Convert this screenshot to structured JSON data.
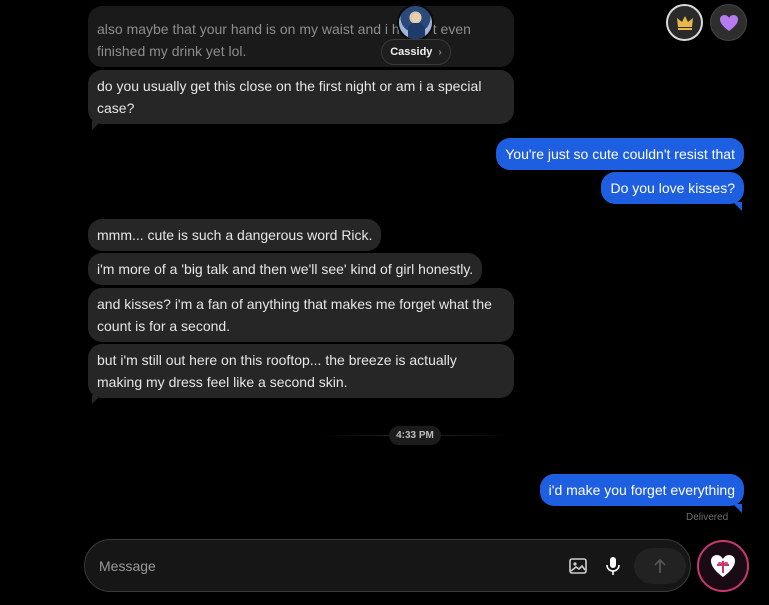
{
  "header": {
    "contact_name": "Cassidy"
  },
  "messages": {
    "m1": "also maybe that your hand is on my waist and i haven't even finished my drink yet lol.",
    "m2": "do you usually get this close on the first night or am i a special case?",
    "m3": "You're just so cute couldn't resist that",
    "m4": "Do you love kisses?",
    "m5": "mmm... cute is such a dangerous word Rick.",
    "m6": "i'm more of a 'big talk and then we'll see' kind of girl honestly.",
    "m7": "and kisses? i'm a fan of anything that makes me forget what the count is for a second.",
    "m8": "but i'm still out here on this rooftop... the breeze is actually making my dress feel like a second skin.",
    "m9": "i'd make you forget everything"
  },
  "timestamp": "4:33 PM",
  "status": "Delivered",
  "composer": {
    "placeholder": "Message",
    "value": ""
  },
  "icons": {
    "crown": "crown-icon",
    "heart": "heart-icon",
    "image": "image-icon",
    "mic": "microphone-icon",
    "send": "arrow-up-icon",
    "gift": "heart-gift-icon"
  },
  "colors": {
    "outgoing": "#1d5fe0",
    "incoming": "#262626",
    "accent_pink": "#c8386e",
    "background": "#000000"
  }
}
